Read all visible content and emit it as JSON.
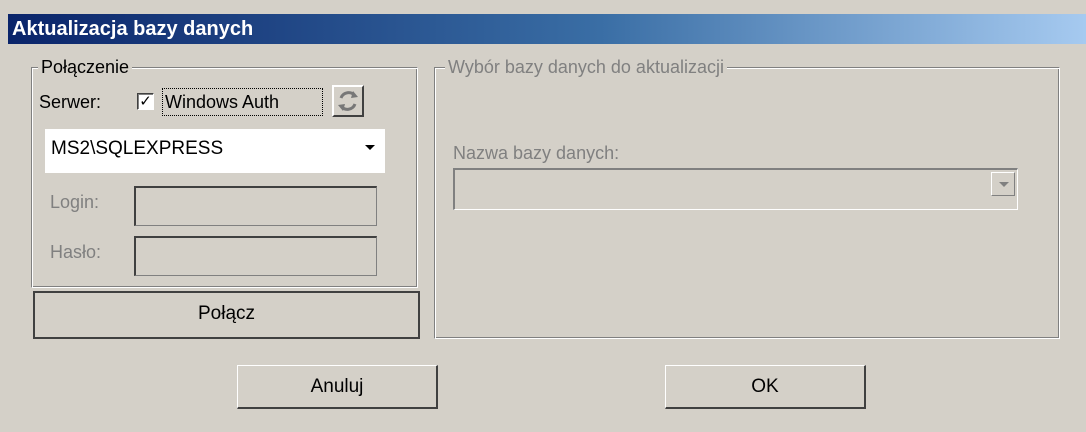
{
  "window": {
    "title": "Aktualizacja bazy danych"
  },
  "connection": {
    "group_label": "Połączenie",
    "server_label": "Serwer:",
    "windows_auth_checked": true,
    "windows_auth_mark": "✓",
    "windows_auth_label": "Windows Auth",
    "refresh_icon": "refresh-icon",
    "server_value": "MS2\\SQLEXPRESS",
    "login_label": "Login:",
    "login_value": "",
    "password_label": "Hasło:",
    "password_value": "",
    "connect_button": "Połącz"
  },
  "database": {
    "group_label": "Wybór bazy danych do aktualizacji",
    "name_label": "Nazwa bazy danych:",
    "name_value": ""
  },
  "footer": {
    "cancel_button": "Anuluj",
    "ok_button": "OK"
  }
}
